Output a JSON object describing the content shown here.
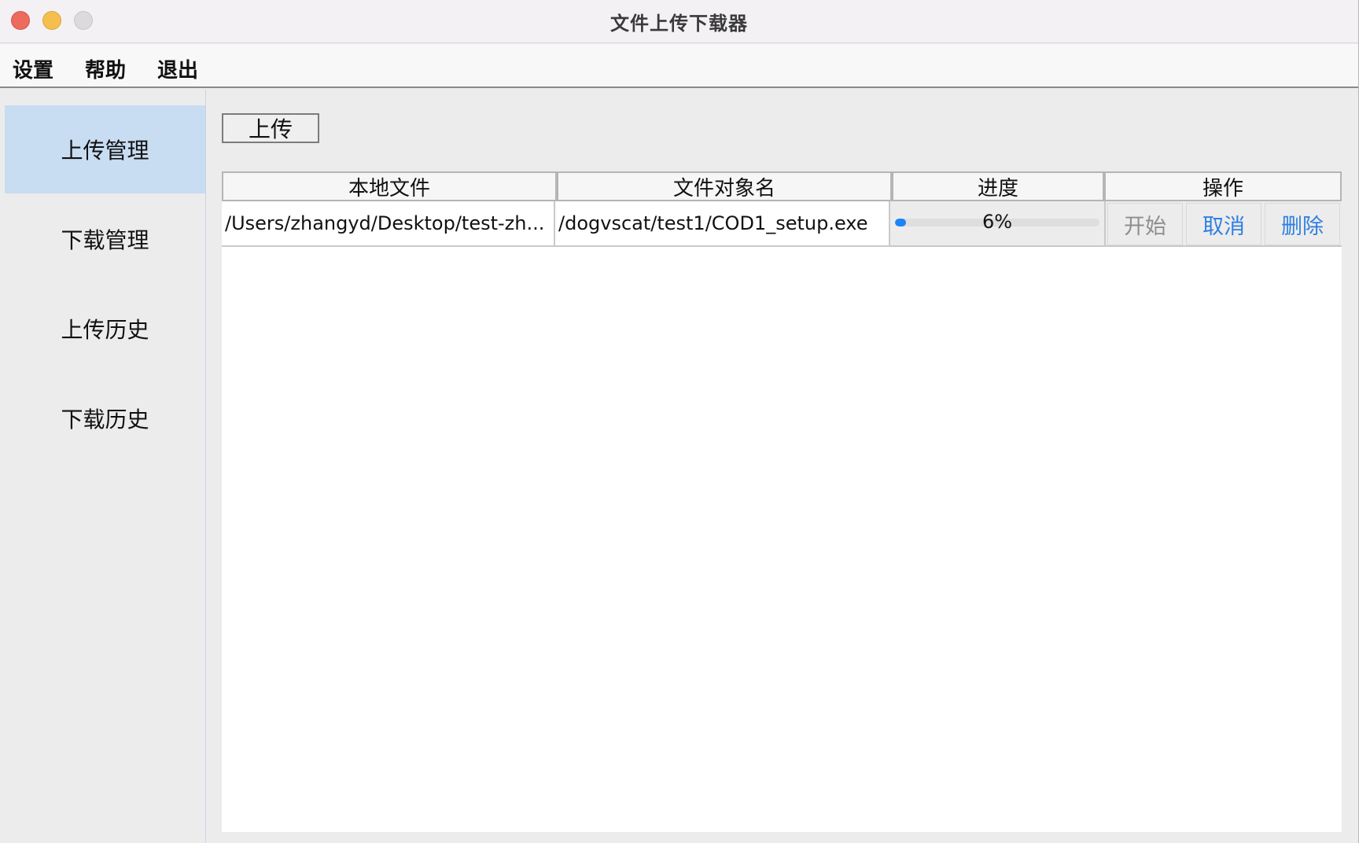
{
  "window": {
    "title": "文件上传下载器"
  },
  "menubar": {
    "items": [
      "设置",
      "帮助",
      "退出"
    ]
  },
  "sidebar": {
    "items": [
      {
        "label": "上传管理",
        "active": true
      },
      {
        "label": "下载管理",
        "active": false
      },
      {
        "label": "上传历史",
        "active": false
      },
      {
        "label": "下载历史",
        "active": false
      }
    ]
  },
  "toolbar": {
    "upload_label": "上传"
  },
  "table": {
    "headers": [
      "本地文件",
      "文件对象名",
      "进度",
      "操作"
    ],
    "rows": [
      {
        "local_file": "/Users/zhangyd/Desktop/test-zh...",
        "object_name": "/dogvscat/test1/COD1_setup.exe",
        "progress_text": "6%",
        "progress_fraction": 0.06,
        "actions": [
          "开始",
          "取消",
          "删除"
        ]
      }
    ]
  },
  "colors": {
    "accent": "#1b84f7",
    "link": "#2f7fe2",
    "sidebar_active": "#c8dcf2",
    "disabled": "#8e8e8e"
  }
}
